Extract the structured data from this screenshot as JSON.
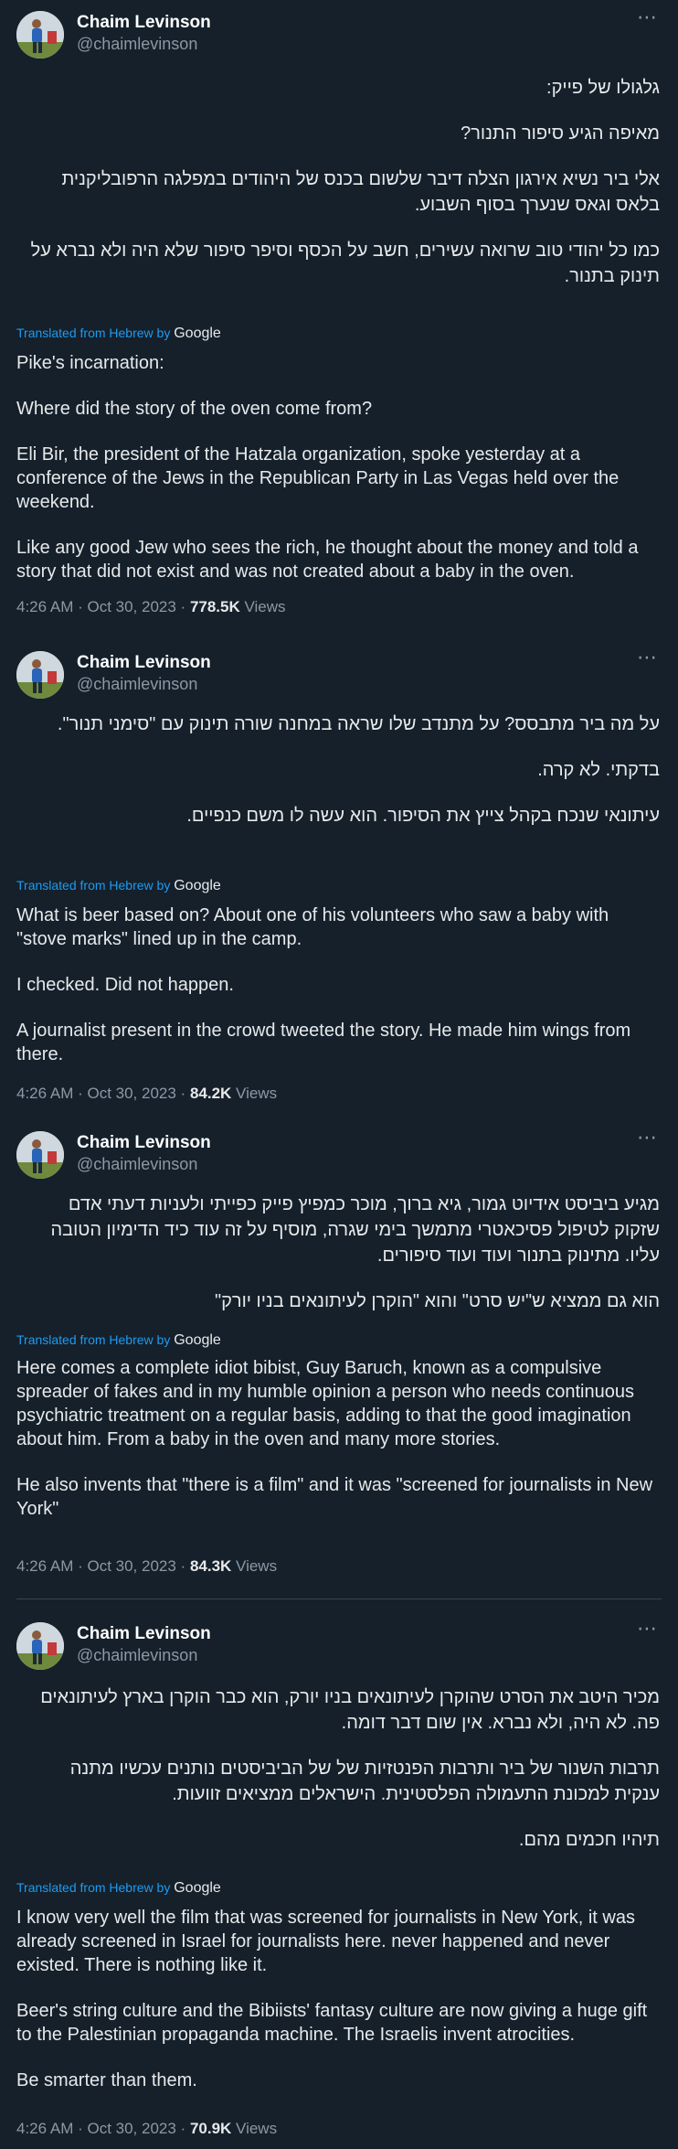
{
  "author": {
    "name": "Chaim Levinson",
    "handle": "@chaimlevinson"
  },
  "more_icon": "⋯",
  "translated_label": "Translated from Hebrew by",
  "translated_brand": "Google",
  "views_label": "Views",
  "tweets": [
    {
      "hebrew": [
        "גלגולו של פייק:",
        "מאיפה הגיע סיפור התנור?",
        "אלי ביר נשיא אירגון הצלה דיבר שלשום בכנס של היהודים במפלגה הרפובליקנית בלאס וגאס שנערך בסוף השבוע.",
        "כמו כל יהודי טוב שרואה עשירים, חשב על הכסף וסיפר סיפור שלא היה ולא נברא על תינוק בתנור."
      ],
      "english": [
        "Pike's incarnation:",
        "Where did the story of the oven come from?",
        "Eli Bir, the president of the Hatzala organization, spoke yesterday at a conference of the Jews in the Republican Party in Las Vegas held over the weekend.",
        "Like any good Jew who sees the rich, he thought about the money and told a story that did not exist and was not created about a baby in the oven."
      ],
      "time": "4:26 AM · Oct 30, 2023 · ",
      "views": "778.5K"
    },
    {
      "hebrew": [
        "על מה ביר מתבסס? על מתנדב שלו שראה במחנה שורה תינוק עם \"סימני תנור\".",
        "בדקתי. לא קרה.",
        "עיתונאי שנכח בקהל צייץ את הסיפור. הוא עשה לו משם כנפיים."
      ],
      "english": [
        "What is beer based on? About one of his volunteers who saw a baby with \"stove marks\" lined up in the camp.",
        "I checked. Did not happen.",
        "A journalist present in the crowd tweeted the story. He made him wings from there."
      ],
      "time": "4:26 AM · Oct 30, 2023 · ",
      "views": "84.2K"
    },
    {
      "hebrew": [
        "מגיע ביביסט אידיוט גמור, גיא ברוך, מוכר כמפיץ פייק כפייתי ולעניות דעתי אדם שזקוק לטיפול פסיכאטרי מתמשך בימי שגרה, מוסיף על זה עוד כיד הדימיון הטובה עליו. מתינוק בתנור ועוד ועוד סיפורים.",
        "הוא גם ממציא ש\"יש סרט\" והוא \"הוקרן לעיתונאים בניו יורק\""
      ],
      "english": [
        "Here comes a complete idiot bibist, Guy Baruch, known as a compulsive spreader of fakes and in my humble opinion a person who needs continuous psychiatric treatment on a regular basis, adding to that the good imagination about him. From a baby in the oven and many more stories.",
        "He also invents that \"there is a film\" and it was \"screened for journalists in New York\""
      ],
      "time": "4:26 AM · Oct 30, 2023 · ",
      "views": "84.3K"
    },
    {
      "hebrew": [
        "מכיר היטב את הסרט שהוקרן לעיתונאים בניו יורק, הוא כבר הוקרן בארץ לעיתונאים פה. לא היה, ולא נברא. אין שום דבר דומה.",
        "תרבות השנור של ביר ותרבות הפנטזיות של של הביביסטים נותנים עכשיו מתנה ענקית למכונת התעמולה הפלסטינית. הישראלים ממציאים זוועות.",
        "תיהיו חכמים מהם."
      ],
      "english": [
        "I know very well the film that was screened for journalists in New York, it was already screened in Israel for journalists here. never happened and never existed. There is nothing like it.",
        "Beer's string culture and the Bibiists' fantasy culture are now giving a huge gift to the Palestinian propaganda machine. The Israelis invent atrocities.",
        "Be smarter than them."
      ],
      "time": "4:26 AM · Oct 30, 2023 · ",
      "views": "70.9K"
    }
  ]
}
